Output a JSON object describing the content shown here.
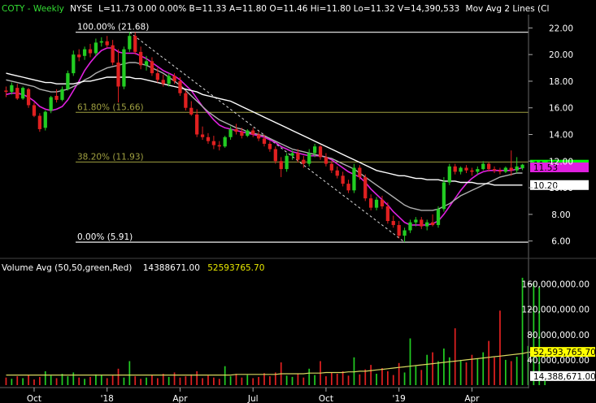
{
  "header": {
    "symbol": "COTY",
    "period": "Weekly",
    "exchange": "NYSE",
    "stats": "L=11.73   0.00   0.00%   B=11.33   A=11.80   O=11.46   Hi=11.80   Lo=11.32   V=14,390,533",
    "indicator": "Mov Avg 2 Lines (Cl"
  },
  "volume_header": {
    "label": "Volume Avg (50,50,green,Red)",
    "value1": "14388671.00",
    "value2": "52593765.70"
  },
  "colors": {
    "background": "#000000",
    "up": "#22cc22",
    "down": "#e02020",
    "ma_fast": "#e020e0",
    "ma_mid": "#b0b0b0",
    "ma_slow": "#ffffff",
    "fib": "#a0a040",
    "vol_avg": "#d8d860",
    "last_price_bg": "#00ff00",
    "ma_fast_bg": "#e020e0",
    "ma_slow_bg": "#ffffff",
    "vol_avg_bg": "#ffff00"
  },
  "chart_data": [
    {
      "type": "candlestick",
      "x_ticks": [
        "Oct",
        "'18",
        "Apr",
        "Jul",
        "Oct",
        "'19",
        "Apr"
      ],
      "y_ticks": [
        6.0,
        8.0,
        10.0,
        12.0,
        14.0,
        16.0,
        18.0,
        20.0,
        22.0
      ],
      "y_tick_labels": [
        "6.00",
        "8.00",
        "10.00",
        "12.00",
        "14.00",
        "16.00",
        "18.00",
        "20.00",
        "22.00"
      ],
      "ylim": [
        5.0,
        23.0
      ],
      "candles": [
        [
          17.3,
          17.6,
          16.8,
          17.2
        ],
        [
          17.2,
          17.9,
          17.0,
          17.7
        ],
        [
          17.5,
          17.8,
          16.6,
          16.7
        ],
        [
          16.7,
          17.6,
          16.6,
          17.5
        ],
        [
          17.4,
          17.5,
          16.0,
          16.2
        ],
        [
          16.2,
          16.4,
          15.3,
          15.4
        ],
        [
          15.4,
          15.6,
          14.2,
          14.4
        ],
        [
          14.5,
          15.8,
          14.3,
          15.7
        ],
        [
          15.8,
          16.9,
          15.6,
          16.8
        ],
        [
          16.9,
          17.4,
          16.4,
          16.6
        ],
        [
          16.6,
          17.6,
          16.5,
          17.4
        ],
        [
          17.4,
          18.8,
          17.3,
          18.6
        ],
        [
          18.6,
          20.3,
          18.4,
          20.0
        ],
        [
          20.0,
          20.4,
          19.5,
          19.8
        ],
        [
          19.9,
          20.6,
          19.6,
          20.4
        ],
        [
          20.4,
          20.8,
          19.8,
          20.1
        ],
        [
          20.1,
          21.2,
          19.9,
          20.9
        ],
        [
          20.9,
          21.3,
          20.6,
          21.0
        ],
        [
          21.0,
          21.4,
          20.5,
          20.7
        ],
        [
          20.7,
          21.1,
          19.2,
          19.4
        ],
        [
          19.4,
          20.4,
          16.4,
          17.6
        ],
        [
          17.6,
          20.6,
          17.4,
          20.4
        ],
        [
          20.4,
          21.7,
          20.2,
          21.4
        ],
        [
          21.4,
          21.68,
          20.0,
          20.2
        ],
        [
          20.2,
          20.6,
          18.9,
          19.2
        ],
        [
          19.2,
          19.9,
          18.8,
          19.5
        ],
        [
          19.5,
          19.8,
          18.4,
          18.6
        ],
        [
          18.6,
          19.0,
          17.9,
          18.1
        ],
        [
          18.1,
          18.5,
          17.6,
          17.8
        ],
        [
          17.8,
          18.6,
          17.6,
          18.4
        ],
        [
          18.4,
          18.6,
          17.8,
          18.0
        ],
        [
          18.0,
          18.3,
          16.9,
          17.1
        ],
        [
          17.1,
          17.3,
          15.8,
          16.0
        ],
        [
          16.0,
          16.5,
          15.4,
          15.5
        ],
        [
          15.5,
          15.9,
          13.8,
          14.0
        ],
        [
          14.0,
          14.6,
          13.6,
          13.8
        ],
        [
          13.8,
          14.1,
          13.3,
          13.5
        ],
        [
          13.5,
          13.9,
          12.9,
          13.2
        ],
        [
          13.2,
          13.5,
          12.8,
          13.1
        ],
        [
          13.1,
          13.9,
          13.0,
          13.8
        ],
        [
          13.8,
          14.6,
          13.6,
          14.4
        ],
        [
          14.4,
          14.8,
          14.0,
          14.2
        ],
        [
          14.2,
          14.5,
          13.7,
          13.9
        ],
        [
          13.9,
          14.4,
          13.8,
          14.3
        ],
        [
          14.3,
          14.5,
          13.8,
          14.0
        ],
        [
          14.0,
          14.2,
          13.5,
          13.7
        ],
        [
          13.7,
          14.0,
          13.1,
          13.3
        ],
        [
          13.3,
          13.5,
          12.7,
          12.9
        ],
        [
          12.9,
          13.1,
          11.8,
          12.0
        ],
        [
          12.0,
          12.3,
          10.8,
          11.4
        ],
        [
          11.4,
          12.6,
          11.2,
          12.4
        ],
        [
          12.4,
          12.8,
          12.1,
          12.6
        ],
        [
          12.6,
          12.9,
          11.9,
          12.1
        ],
        [
          12.1,
          12.4,
          11.5,
          11.8
        ],
        [
          11.8,
          12.9,
          11.6,
          12.6
        ],
        [
          12.6,
          13.3,
          12.3,
          13.1
        ],
        [
          13.1,
          13.2,
          12.1,
          12.3
        ],
        [
          12.3,
          12.6,
          11.6,
          11.8
        ],
        [
          11.8,
          12.0,
          11.1,
          11.3
        ],
        [
          11.3,
          11.6,
          10.7,
          10.9
        ],
        [
          10.9,
          11.2,
          10.1,
          10.3
        ],
        [
          10.3,
          10.6,
          9.6,
          9.8
        ],
        [
          9.8,
          11.8,
          9.6,
          11.5
        ],
        [
          11.5,
          11.7,
          10.6,
          10.8
        ],
        [
          10.8,
          11.0,
          9.0,
          9.2
        ],
        [
          9.2,
          9.5,
          8.3,
          8.5
        ],
        [
          8.5,
          9.3,
          8.3,
          9.1
        ],
        [
          9.1,
          9.4,
          8.4,
          8.6
        ],
        [
          8.6,
          8.9,
          7.3,
          7.5
        ],
        [
          7.5,
          7.9,
          7.0,
          7.2
        ],
        [
          7.2,
          7.5,
          6.2,
          6.4
        ],
        [
          6.4,
          7.0,
          5.91,
          6.8
        ],
        [
          6.8,
          7.6,
          6.6,
          7.4
        ],
        [
          7.4,
          7.8,
          7.1,
          7.6
        ],
        [
          7.6,
          7.8,
          6.9,
          7.1
        ],
        [
          7.1,
          7.6,
          6.8,
          7.4
        ],
        [
          7.4,
          8.0,
          7.1,
          7.2
        ],
        [
          7.2,
          8.6,
          7.0,
          8.4
        ],
        [
          8.4,
          10.8,
          8.2,
          10.4
        ],
        [
          10.4,
          11.8,
          10.2,
          11.6
        ],
        [
          11.6,
          11.8,
          11.0,
          11.2
        ],
        [
          11.2,
          11.6,
          11.0,
          11.5
        ],
        [
          11.5,
          11.7,
          11.1,
          11.3
        ],
        [
          11.3,
          11.5,
          10.9,
          11.2
        ],
        [
          11.2,
          11.6,
          11.0,
          11.4
        ],
        [
          11.4,
          12.0,
          11.3,
          11.8
        ],
        [
          11.8,
          11.9,
          11.2,
          11.4
        ],
        [
          11.4,
          11.6,
          11.1,
          11.3
        ],
        [
          11.3,
          11.5,
          11.0,
          11.2
        ],
        [
          11.2,
          11.6,
          11.1,
          11.5
        ],
        [
          11.5,
          12.8,
          10.9,
          11.3
        ],
        [
          11.3,
          12.3,
          11.1,
          11.6
        ],
        [
          11.46,
          11.8,
          11.32,
          11.73
        ]
      ],
      "moving_averages": [
        {
          "key": "ma_fast",
          "values": [
            17.0,
            17.1,
            17.1,
            17.0,
            16.8,
            16.5,
            16.1,
            15.9,
            15.8,
            15.9,
            16.1,
            16.6,
            17.3,
            18.0,
            18.8,
            19.4,
            19.9,
            20.3,
            20.5,
            20.5,
            20.2,
            20.1,
            20.1,
            20.1,
            19.9,
            19.7,
            19.4,
            19.1,
            18.8,
            18.6,
            18.4,
            18.1,
            17.7,
            17.3,
            16.7,
            16.1,
            15.6,
            15.1,
            14.7,
            14.5,
            14.4,
            14.3,
            14.2,
            14.1,
            14.0,
            13.9,
            13.8,
            13.6,
            13.4,
            13.1,
            12.9,
            12.7,
            12.6,
            12.5,
            12.4,
            12.4,
            12.4,
            12.3,
            12.1,
            11.8,
            11.5,
            11.2,
            11.0,
            10.8,
            10.4,
            9.9,
            9.5,
            9.1,
            8.7,
            8.2,
            7.8,
            7.4,
            7.2,
            7.2,
            7.2,
            7.2,
            7.3,
            7.5,
            8.0,
            8.6,
            9.2,
            9.8,
            10.3,
            10.7,
            11.0,
            11.2,
            11.3,
            11.3,
            11.3,
            11.3,
            11.3,
            11.4,
            11.5
          ]
        },
        {
          "key": "ma_mid",
          "values": [
            18.1,
            18.0,
            17.9,
            17.8,
            17.7,
            17.6,
            17.4,
            17.3,
            17.2,
            17.2,
            17.3,
            17.4,
            17.6,
            17.8,
            18.1,
            18.3,
            18.6,
            18.8,
            19.0,
            19.1,
            19.2,
            19.3,
            19.4,
            19.4,
            19.3,
            19.2,
            19.0,
            18.8,
            18.6,
            18.3,
            18.0,
            17.7,
            17.3,
            16.9,
            16.5,
            16.1,
            15.7,
            15.4,
            15.1,
            14.9,
            14.7,
            14.5,
            14.4,
            14.2,
            14.1,
            14.0,
            13.9,
            13.7,
            13.5,
            13.3,
            13.1,
            12.9,
            12.8,
            12.7,
            12.6,
            12.5,
            12.4,
            12.3,
            12.2,
            12.0,
            11.8,
            11.6,
            11.4,
            11.1,
            10.8,
            10.5,
            10.2,
            9.9,
            9.6,
            9.3,
            9.0,
            8.7,
            8.5,
            8.4,
            8.3,
            8.3,
            8.3,
            8.4,
            8.6,
            8.8,
            9.1,
            9.4,
            9.6,
            9.8,
            10.0,
            10.2,
            10.4,
            10.6,
            10.8,
            10.9,
            11.0,
            11.1,
            11.1
          ]
        },
        {
          "key": "ma_slow",
          "values": [
            18.6,
            18.5,
            18.4,
            18.3,
            18.2,
            18.1,
            18.0,
            17.9,
            17.9,
            17.8,
            17.8,
            17.8,
            17.8,
            17.9,
            18.0,
            18.0,
            18.1,
            18.2,
            18.3,
            18.3,
            18.3,
            18.3,
            18.3,
            18.2,
            18.2,
            18.1,
            18.0,
            17.9,
            17.8,
            17.7,
            17.6,
            17.5,
            17.4,
            17.3,
            17.2,
            17.0,
            16.9,
            16.8,
            16.7,
            16.6,
            16.5,
            16.3,
            16.1,
            15.9,
            15.7,
            15.5,
            15.3,
            15.1,
            14.9,
            14.7,
            14.5,
            14.3,
            14.1,
            13.9,
            13.7,
            13.5,
            13.3,
            13.1,
            12.9,
            12.7,
            12.5,
            12.3,
            12.1,
            11.9,
            11.7,
            11.5,
            11.3,
            11.2,
            11.1,
            11.0,
            10.9,
            10.9,
            10.8,
            10.7,
            10.7,
            10.6,
            10.6,
            10.6,
            10.5,
            10.5,
            10.5,
            10.4,
            10.4,
            10.4,
            10.3,
            10.3,
            10.3,
            10.2,
            10.2,
            10.2,
            10.2,
            10.2,
            10.2
          ]
        }
      ],
      "fib_levels": [
        {
          "label": "100.00% (21.68)",
          "value": 21.68
        },
        {
          "label": "61.80% (15.66)",
          "value": 15.66
        },
        {
          "label": "38.20% (11.93)",
          "value": 11.93
        },
        {
          "label": "0.00% (5.91)",
          "value": 5.91
        }
      ],
      "trendline": {
        "from": [
          22,
          21.68
        ],
        "to": [
          71,
          5.91
        ]
      },
      "price_labels": [
        {
          "text": "11.73",
          "value": 11.73,
          "key": "last_price_bg"
        },
        {
          "text": "11.53",
          "value": 11.53,
          "key": "ma_fast_bg"
        },
        {
          "text": "10.20",
          "value": 10.2,
          "key": "ma_slow_bg"
        }
      ]
    },
    {
      "type": "bar",
      "x_ticks": [
        "Oct",
        "'18",
        "Apr",
        "Jul",
        "Oct",
        "'19",
        "Apr"
      ],
      "y_ticks": [
        40000000,
        80000000,
        120000000,
        160000000
      ],
      "y_tick_labels": [
        "40,000,000.00",
        "80,000,000.00",
        "120,000,000.00",
        "160,000,000.00"
      ],
      "ylim": [
        0,
        175000000
      ],
      "volume": [
        12,
        10,
        14,
        11,
        16,
        9,
        13,
        22,
        15,
        11,
        18,
        14,
        20,
        12,
        10,
        13,
        17,
        16,
        11,
        15,
        26,
        12,
        38,
        14,
        10,
        12,
        16,
        11,
        18,
        13,
        20,
        12,
        14,
        17,
        22,
        11,
        15,
        12,
        10,
        30,
        14,
        18,
        12,
        16,
        11,
        13,
        19,
        14,
        20,
        36,
        15,
        13,
        18,
        12,
        26,
        16,
        38,
        14,
        20,
        18,
        22,
        15,
        44,
        17,
        25,
        32,
        18,
        27,
        22,
        16,
        35,
        20,
        74,
        30,
        24,
        48,
        52,
        38,
        58,
        44,
        90,
        40,
        36,
        48,
        42,
        52,
        70,
        44,
        118,
        40,
        38,
        45,
        170,
        62,
        162,
        155,
        15
      ],
      "volume_colors": "up_down_from_candles",
      "avg_line": [
        16,
        16,
        16,
        16,
        16,
        16,
        16,
        16,
        16,
        16,
        16,
        16,
        16,
        16,
        16,
        16,
        16,
        16,
        16,
        16,
        16,
        16,
        16,
        16,
        16,
        16,
        16,
        16,
        16,
        16,
        16,
        16,
        16,
        16,
        16,
        16,
        16,
        16,
        16,
        16,
        16,
        17,
        17,
        17,
        17,
        17,
        17,
        17,
        17,
        18,
        18,
        18,
        18,
        18,
        19,
        19,
        19,
        20,
        20,
        20,
        20,
        21,
        21,
        22,
        22,
        23,
        24,
        25,
        26,
        27,
        28,
        29,
        30,
        31,
        32,
        33,
        34,
        35,
        36,
        37,
        38,
        39,
        40,
        41,
        42,
        43,
        44,
        45,
        46,
        47,
        48,
        49,
        50,
        52,
        52.6,
        52.6,
        52.6
      ],
      "value_labels": [
        {
          "text": "52,593,765.70",
          "value": 52593765.7,
          "key": "vol_avg_bg"
        },
        {
          "text": "14,388,671.00",
          "value": 14388671,
          "key": "ma_slow_bg"
        }
      ]
    }
  ]
}
